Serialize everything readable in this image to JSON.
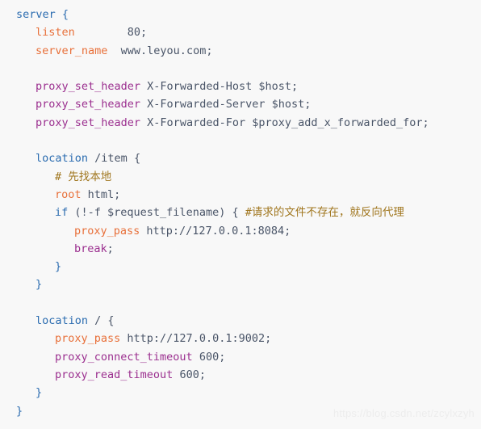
{
  "document": {
    "kind": "nginx-config-snippet",
    "language": "nginx",
    "background_color": "#f8f8f8",
    "colors": {
      "keyword_blue": "#2b6cb0",
      "directive_orange": "#e8703a",
      "directive_purple": "#9b2f8f",
      "plain_text": "#4a5568",
      "comment": "#a0761e",
      "watermark": "#ededed"
    }
  },
  "watermark": {
    "text": "https://blog.csdn.net/zcylxzyh"
  },
  "code": {
    "lines": [
      {
        "indent": 0,
        "tokens": [
          {
            "c": "blue",
            "t": "server"
          },
          {
            "c": "plain",
            "t": " "
          },
          {
            "c": "brace",
            "t": "{"
          }
        ]
      },
      {
        "indent": 1,
        "tokens": [
          {
            "c": "orange",
            "t": "listen"
          },
          {
            "c": "plain",
            "t": "        80;"
          }
        ]
      },
      {
        "indent": 1,
        "tokens": [
          {
            "c": "orange",
            "t": "server_name"
          },
          {
            "c": "plain",
            "t": "  www.leyou.com;"
          }
        ]
      },
      {
        "indent": 0,
        "tokens": []
      },
      {
        "indent": 1,
        "tokens": [
          {
            "c": "purple",
            "t": "proxy_set_header"
          },
          {
            "c": "plain",
            "t": " X-Forwarded-Host $host;"
          }
        ]
      },
      {
        "indent": 1,
        "tokens": [
          {
            "c": "purple",
            "t": "proxy_set_header"
          },
          {
            "c": "plain",
            "t": " X-Forwarded-Server $host;"
          }
        ]
      },
      {
        "indent": 1,
        "tokens": [
          {
            "c": "purple",
            "t": "proxy_set_header"
          },
          {
            "c": "plain",
            "t": " X-Forwarded-For $proxy_add_x_forwarded_for;"
          }
        ]
      },
      {
        "indent": 0,
        "tokens": []
      },
      {
        "indent": 1,
        "tokens": [
          {
            "c": "blue",
            "t": "location"
          },
          {
            "c": "plain",
            "t": " /item "
          },
          {
            "c": "plain",
            "t": "{"
          }
        ]
      },
      {
        "indent": 2,
        "tokens": [
          {
            "c": "comment",
            "t": "# 先找本地"
          }
        ]
      },
      {
        "indent": 2,
        "tokens": [
          {
            "c": "orange",
            "t": "root"
          },
          {
            "c": "plain",
            "t": " html;"
          }
        ]
      },
      {
        "indent": 2,
        "tokens": [
          {
            "c": "blue",
            "t": "if"
          },
          {
            "c": "plain",
            "t": " (!-f $request_filename) { "
          },
          {
            "c": "comment",
            "t": "#请求的文件不存在，就反向代理"
          }
        ]
      },
      {
        "indent": 3,
        "tokens": [
          {
            "c": "orange",
            "t": "proxy_pass"
          },
          {
            "c": "plain",
            "t": " http://127.0.0.1:8084;"
          }
        ]
      },
      {
        "indent": 3,
        "tokens": [
          {
            "c": "purple",
            "t": "break"
          },
          {
            "c": "plain",
            "t": ";"
          }
        ]
      },
      {
        "indent": 2,
        "tokens": [
          {
            "c": "brace",
            "t": "}"
          }
        ]
      },
      {
        "indent": 1,
        "tokens": [
          {
            "c": "brace",
            "t": "}"
          }
        ]
      },
      {
        "indent": 0,
        "tokens": []
      },
      {
        "indent": 1,
        "tokens": [
          {
            "c": "blue",
            "t": "location"
          },
          {
            "c": "plain",
            "t": " / "
          },
          {
            "c": "plain",
            "t": "{"
          }
        ]
      },
      {
        "indent": 2,
        "tokens": [
          {
            "c": "orange",
            "t": "proxy_pass"
          },
          {
            "c": "plain",
            "t": " http://127.0.0.1:9002;"
          }
        ]
      },
      {
        "indent": 2,
        "tokens": [
          {
            "c": "purple",
            "t": "proxy_connect_timeout"
          },
          {
            "c": "plain",
            "t": " 600;"
          }
        ]
      },
      {
        "indent": 2,
        "tokens": [
          {
            "c": "purple",
            "t": "proxy_read_timeout"
          },
          {
            "c": "plain",
            "t": " 600;"
          }
        ]
      },
      {
        "indent": 1,
        "tokens": [
          {
            "c": "brace",
            "t": "}"
          }
        ]
      },
      {
        "indent": 0,
        "tokens": [
          {
            "c": "brace",
            "t": "}"
          }
        ]
      }
    ],
    "plain_text": "server {\n    listen        80;\n    server_name  www.leyou.com;\n\n    proxy_set_header X-Forwarded-Host $host;\n    proxy_set_header X-Forwarded-Server $host;\n    proxy_set_header X-Forwarded-For $proxy_add_x_forwarded_for;\n\n    location /item {\n        # 先找本地\n        root html;\n        if (!-f $request_filename) { #请求的文件不存在，就反向代理\n            proxy_pass http://127.0.0.1:8084;\n            break;\n        }\n    }\n\n    location / {\n        proxy_pass http://127.0.0.1:9002;\n        proxy_connect_timeout 600;\n        proxy_read_timeout 600;\n    }\n}"
  }
}
